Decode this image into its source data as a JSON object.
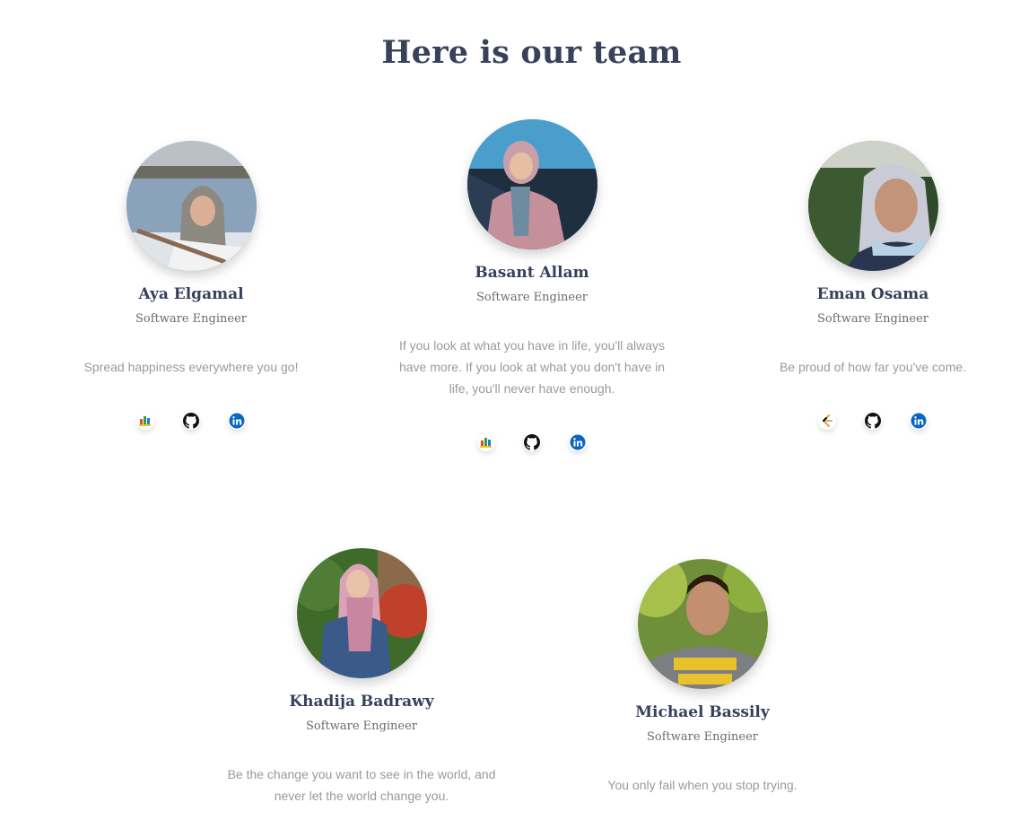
{
  "page": {
    "title": "Here is our team"
  },
  "members": [
    {
      "name": "Aya Elgamal",
      "role": "Software Engineer",
      "quote": "Spread happiness everywhere you go!"
    },
    {
      "name": "Basant Allam",
      "role": "Software Engineer",
      "quote": "If you look at what you have in life, you'll always have more. If you look at what you don't have in life, you'll never have enough."
    },
    {
      "name": "Eman Osama",
      "role": "Software Engineer",
      "quote": "Be proud of how far you've come."
    },
    {
      "name": "Khadija Badrawy",
      "role": "Software Engineer",
      "quote": "Be the change you want to see in the world, and never let the world change you."
    },
    {
      "name": "Michael Bassily",
      "role": "Software Engineer",
      "quote": "You only fail when you stop trying."
    }
  ],
  "icons": {
    "profile_a": "bar-chart-icon",
    "profile_b": "leetcode-icon",
    "github": "github-icon",
    "linkedin": "linkedin-icon"
  },
  "colors": {
    "heading": "#37425a",
    "quote": "#9a9a9a",
    "linkedin": "#0a66c2",
    "github": "#111111"
  }
}
